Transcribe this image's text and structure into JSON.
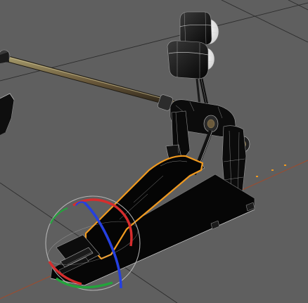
{
  "viewport": {
    "background": "#5f5f5f",
    "grid_color": "#2c2c2c",
    "axis_color": "#a14a2b",
    "selection_color": "#f19a1f",
    "gizmo": {
      "x_color": "#d62d2d",
      "y_color": "#22a43b",
      "z_color": "#2540e0",
      "sphere_color": "#bdbdbd"
    }
  },
  "scene": {
    "object": "kick-drum-pedal",
    "selected_part": "footboard"
  }
}
